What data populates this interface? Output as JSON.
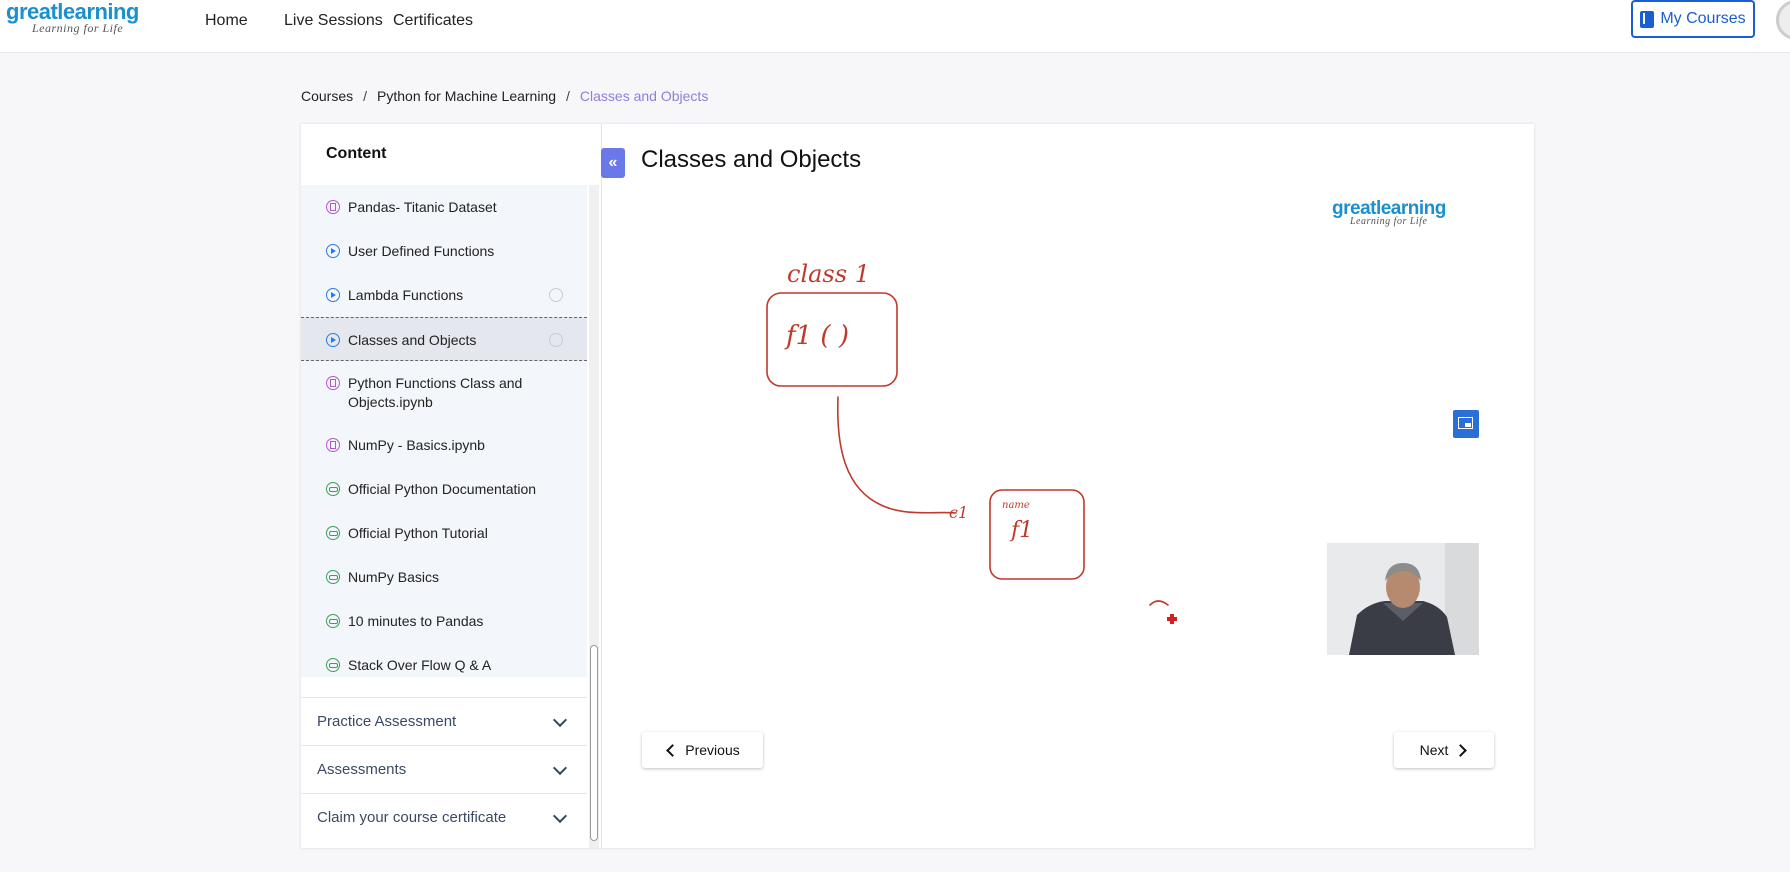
{
  "header": {
    "logo_main": "greatlearning",
    "logo_sub": "Learning for Life",
    "nav": [
      "Home",
      "Live Sessions",
      "Certificates"
    ],
    "my_courses": "My Courses"
  },
  "breadcrumb": {
    "items": [
      "Courses",
      "Python for Machine Learning",
      "Classes and Objects"
    ],
    "separator": "/"
  },
  "sidebar": {
    "heading": "Content",
    "items": [
      {
        "label": "Pandas- Titanic Dataset",
        "icon": "pdf-icon"
      },
      {
        "label": "User Defined Functions",
        "icon": "play-icon"
      },
      {
        "label": "Lambda Functions",
        "icon": "play-icon"
      },
      {
        "label": "Classes and Objects",
        "icon": "play-icon"
      },
      {
        "label": "Python Functions Class and Objects.ipynb",
        "icon": "pdf-icon"
      },
      {
        "label": "NumPy - Basics.ipynb",
        "icon": "pdf-icon"
      },
      {
        "label": "Official Python Documentation",
        "icon": "link-icon"
      },
      {
        "label": "Official Python Tutorial",
        "icon": "link-icon"
      },
      {
        "label": "NumPy Basics",
        "icon": "link-icon"
      },
      {
        "label": "10 minutes to Pandas",
        "icon": "link-icon"
      },
      {
        "label": "Stack Over Flow Q & A",
        "icon": "link-icon"
      }
    ],
    "sections": [
      "Practice Assessment",
      "Assessments",
      "Claim your course certificate"
    ],
    "collapse_glyph": "«"
  },
  "main": {
    "title": "Classes and Objects",
    "watermark_main": "greatlearning",
    "watermark_sub": "Learning for Life",
    "sketch": {
      "label_top": "class 1",
      "box1": "f1 ( )",
      "box2_top": "name",
      "box2": "f1",
      "connector": "c1"
    },
    "prev_label": "Previous",
    "next_label": "Next"
  },
  "colors": {
    "brand": "#1a8fd1",
    "accent": "#6a78ea",
    "button_blue": "#1a5fd1",
    "ink": "#c0392b"
  }
}
